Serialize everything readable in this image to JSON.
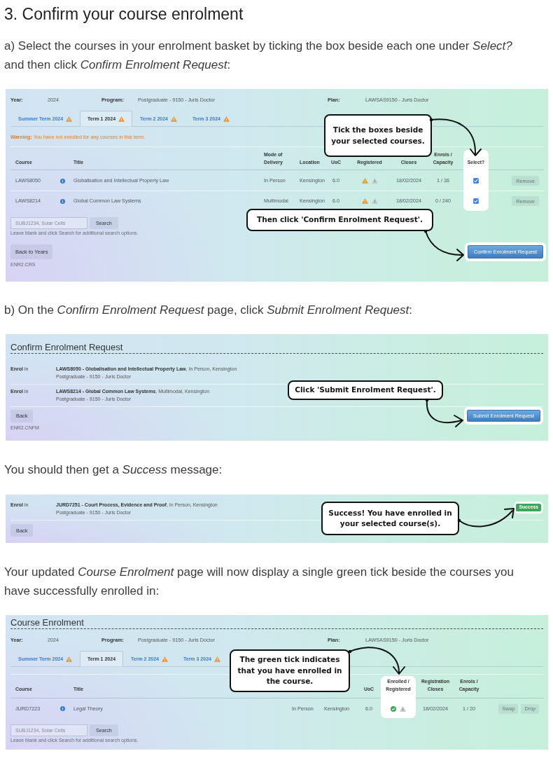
{
  "heading": "3. Confirm your course enrolment",
  "step_a": "a) Select the courses in your enrolment basket by ticking the box beside each one under *Select?* and then click *Confirm Enrolment Request*:",
  "basket_page": {
    "info": [
      {
        "label": "Year:",
        "value": "2024"
      },
      {
        "label": "Program:",
        "value": "Postgraduate - 9150 - Juris Doctor"
      },
      {
        "label": "Plan:",
        "value": "LAWSAS9150 - Juris Doctor"
      }
    ],
    "tabs": [
      {
        "label": "Summer Term 2024",
        "warning": true,
        "selected": false
      },
      {
        "label": "Term 1 2024",
        "warning": true,
        "selected": true
      },
      {
        "label": "Term 2 2024",
        "warning": true,
        "selected": false
      },
      {
        "label": "Term 3 2024",
        "warning": true,
        "selected": false
      }
    ],
    "notice": "**Warning:** You have not enrolled for any courses in this term.",
    "columns": [
      {
        "kind": "course",
        "label": "Course",
        "highlighted": false
      },
      {
        "kind": "title",
        "label": "Title",
        "highlighted": false
      },
      {
        "kind": "delivery",
        "label": "Mode of Delivery",
        "highlighted": false
      },
      {
        "kind": "location",
        "label": "Location",
        "highlighted": false
      },
      {
        "kind": "uoc",
        "label": "UoC",
        "highlighted": false
      },
      {
        "kind": "status",
        "label": "Registered",
        "highlighted": false
      },
      {
        "kind": "closes",
        "label": "Closes",
        "highlighted": false
      },
      {
        "kind": "enrols",
        "label": "Enrols / Capacity",
        "highlighted": false
      },
      {
        "kind": "select",
        "label": "Select?",
        "highlighted": true
      }
    ],
    "rows": [
      {
        "course": "LAWS8050",
        "title": "Globalisation and Intellectual Property Law",
        "delivery": "In Person",
        "location": "Kensington",
        "uoc": "6.0",
        "enrolled": false,
        "registered": false,
        "closes": "18/02/2024",
        "enrols": "1 / 36",
        "checked": true,
        "actions": [
          "Remove"
        ]
      },
      {
        "course": "LAWS8214",
        "title": "Global Common Law Systems",
        "delivery": "Multimodal",
        "location": "Kensington",
        "uoc": "6.0",
        "enrolled": false,
        "registered": false,
        "closes": "18/02/2024",
        "enrols": "0 / 240",
        "checked": true,
        "actions": [
          "Remove"
        ]
      }
    ],
    "search": {
      "placeholder": "SUBJ1234, Solar Cells",
      "button": "Search",
      "hint": "Leave blank and click Search for additional search options."
    },
    "back_button": "Back to Years",
    "submit_button": {
      "label": "Confirm Enrolment Request",
      "highlighted": true
    },
    "page_code": "ENR2.CRS",
    "callouts": [
      "Tick the boxes beside your selected courses.",
      "Then click 'Confirm Enrolment Request'."
    ]
  },
  "step_b": "b) On the *Confirm Enrolment Request* page, click *Submit Enrolment Request*:",
  "confirm_page": {
    "heading": "Confirm Enrolment Request",
    "requests": [
      {
        "label": "**Enrol** in",
        "course": "**LAWS8050 - Globalisation and Intellectual Property Law**, In Person, Kensington",
        "program": "Postgraduate - 9150 - Juris Doctor"
      },
      {
        "label": "**Enrol** in",
        "course": "**LAWS8214 - Global Common Law Systems**, Multimodal, Kensington",
        "program": "Postgraduate - 9150 - Juris Doctor"
      }
    ],
    "back_button": "Back",
    "submit_button": {
      "label": "Submit Enrolment Request",
      "highlighted": true
    },
    "page_code": "ENR2.CNFM",
    "callouts": [
      "Click 'Submit Enrolment Request'."
    ]
  },
  "step_c": "You should then get a *Success* message:",
  "success_page": {
    "requests": [
      {
        "label": "**Enrol** in",
        "course": "**JURD7251 - Court Process, Evidence and Proof**, In Person, Kensington",
        "program": "Postgraduate - 9150 - Juris Doctor",
        "status": {
          "label": "Success",
          "highlighted": true
        }
      }
    ],
    "back_button": "Back",
    "callouts": [
      "Success! You have enrolled in your selected course(s)."
    ]
  },
  "step_d": "Your updated *Course Enrolment* page will now display a single green tick beside the courses you have successfully enrolled in:",
  "updated_page": {
    "heading": "Course Enrolment",
    "info": [
      {
        "label": "Year:",
        "value": "2024"
      },
      {
        "label": "Program:",
        "value": "Postgraduate - 9150 - Juris Doctor"
      },
      {
        "label": "Plan:",
        "value": "LAWSAS9150 - Juris Doctor"
      }
    ],
    "tabs": [
      {
        "label": "Summer Term 2024",
        "warning": true,
        "selected": false
      },
      {
        "label": "Term 1 2024",
        "warning": false,
        "selected": true
      },
      {
        "label": "Term 2 2024",
        "warning": true,
        "selected": false
      },
      {
        "label": "Term 3 2024",
        "warning": true,
        "selected": false
      }
    ],
    "columns": [
      {
        "kind": "course",
        "label": "Course",
        "highlighted": false
      },
      {
        "kind": "title",
        "label": "Title",
        "highlighted": false
      },
      {
        "kind": "uoc",
        "label": "UoC",
        "highlighted": false
      },
      {
        "kind": "status",
        "label": "Enrolled / Registered",
        "highlighted": true
      },
      {
        "kind": "closes",
        "label": "Registration Closes",
        "highlighted": false
      },
      {
        "kind": "enrols",
        "label": "Enrols / Capacity",
        "highlighted": false
      }
    ],
    "rows": [
      {
        "course": "JURD7223",
        "title": "Legal Theory",
        "delivery": "In Person",
        "location": "Kensington",
        "uoc": "6.0",
        "enrolled": true,
        "registered": false,
        "closes": "18/02/2024",
        "enrols": "1 / 20",
        "actions": [
          "Swap",
          "Drop"
        ]
      }
    ],
    "search": {
      "placeholder": "SUBJ1234, Solar Cells",
      "button": "Search",
      "hint": "Leave blank and click Search for additional search options."
    },
    "callouts": [
      "The green tick indicates that you have enrolled in the course."
    ]
  }
}
